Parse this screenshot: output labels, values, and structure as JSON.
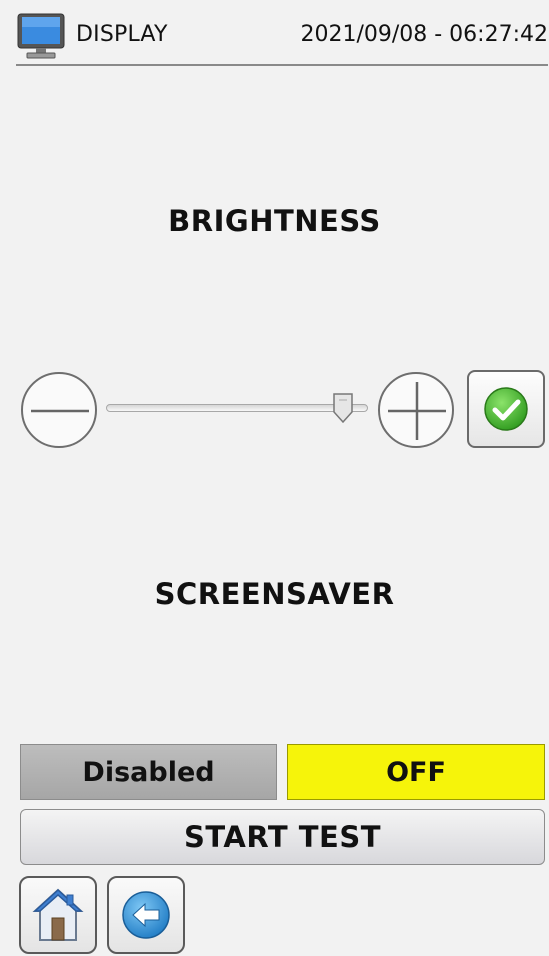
{
  "header": {
    "icon": "monitor-icon",
    "title": "DISPLAY",
    "datetime": "2021/09/08 - 06:27:42"
  },
  "brightness": {
    "title": "BRIGHTNESS",
    "level": 0.94,
    "decrease_icon": "minus-circle-icon",
    "increase_icon": "plus-circle-icon",
    "confirm_icon": "check-circle-icon"
  },
  "screensaver": {
    "title": "SCREENSAVER",
    "state_label": "Disabled",
    "mode_label": "OFF",
    "mode_color": "#f6f40a"
  },
  "actions": {
    "start_test_label": "START TEST"
  },
  "nav": {
    "home_icon": "home-icon",
    "back_icon": "back-arrow-icon"
  }
}
